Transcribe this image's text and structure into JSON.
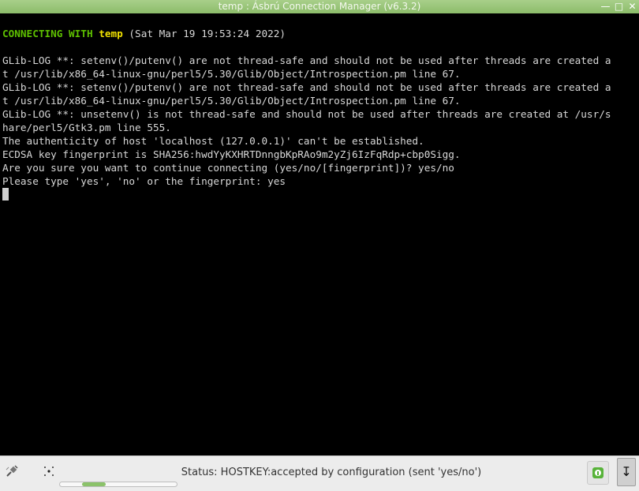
{
  "window": {
    "title": "temp : Ásbrú Connection Manager (v6.3.2)",
    "controls": [
      "minimize-icon",
      "maximize-icon",
      "close-icon"
    ]
  },
  "terminal": {
    "connect_prefix": "CONNECTING WITH",
    "connect_name": "temp",
    "connect_time": "(Sat Mar 19 19:53:24 2022)",
    "lines": [
      "",
      "GLib-LOG **: setenv()/putenv() are not thread-safe and should not be used after threads are created a",
      "t /usr/lib/x86_64-linux-gnu/perl5/5.30/Glib/Object/Introspection.pm line 67.",
      "GLib-LOG **: setenv()/putenv() are not thread-safe and should not be used after threads are created a",
      "t /usr/lib/x86_64-linux-gnu/perl5/5.30/Glib/Object/Introspection.pm line 67.",
      "GLib-LOG **: unsetenv() is not thread-safe and should not be used after threads are created at /usr/s",
      "hare/perl5/Gtk3.pm line 555.",
      "The authenticity of host 'localhost (127.0.0.1)' can't be established.",
      "ECDSA key fingerprint is SHA256:hwdYyKXHRTDnngbKpRAo9m2yZj6IzFqRdp+cbp0Sigg.",
      "Are you sure you want to continue connecting (yes/no/[fingerprint])? yes/no",
      "Please type 'yes', 'no' or the fingerprint: yes"
    ]
  },
  "statusbar": {
    "status_text": "Status: HOSTKEY:accepted by configuration (sent 'yes/no')",
    "icons": {
      "left1": "plug-disconnect-icon",
      "left2": "sparkle-icon",
      "keep": "info-toggle-icon",
      "scroll": "scroll-lock-arrow-icon"
    },
    "scroll_thumb_fraction": 0.2,
    "accent": "#8bc26a"
  }
}
